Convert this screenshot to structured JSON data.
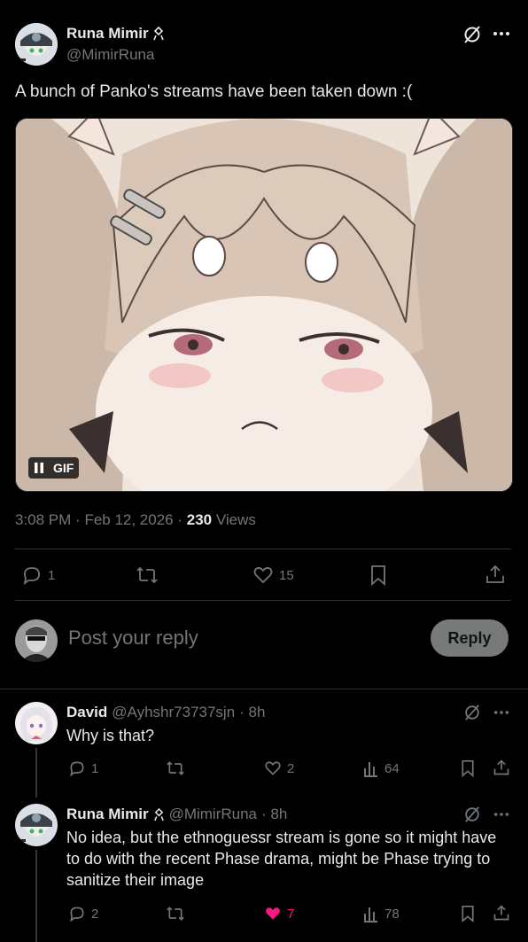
{
  "tweet": {
    "author_name": "Runa Mimir",
    "author_handle": "@MimirRuna",
    "text": "A bunch of Panko's streams have been taken down :(",
    "media_badge": "GIF",
    "time": "3:08 PM",
    "date": "Feb 12, 2026",
    "views_count": "230",
    "views_label": "Views",
    "replies": "1",
    "likes": "15"
  },
  "composer": {
    "placeholder": "Post your reply",
    "reply_button": "Reply"
  },
  "replies": [
    {
      "name": "David",
      "handle": "@Ayhshr73737sjn",
      "age": "· 8h",
      "text": "Why is that?",
      "replies": "1",
      "likes": "2",
      "views": "64",
      "liked": false
    },
    {
      "name": "Runa Mimir",
      "handle": "@MimirRuna",
      "age": "· 8h",
      "text": "No idea, but the ethnoguessr stream is gone so it might have to do with the recent Phase drama, might be Phase trying to sanitize their image",
      "replies": "2",
      "likes": "7",
      "views": "78",
      "liked": true
    }
  ],
  "colors": {
    "background": "#000000",
    "text": "#e7e9ea",
    "muted": "#71767b",
    "like_active": "#f91880",
    "divider": "#2f3336"
  }
}
